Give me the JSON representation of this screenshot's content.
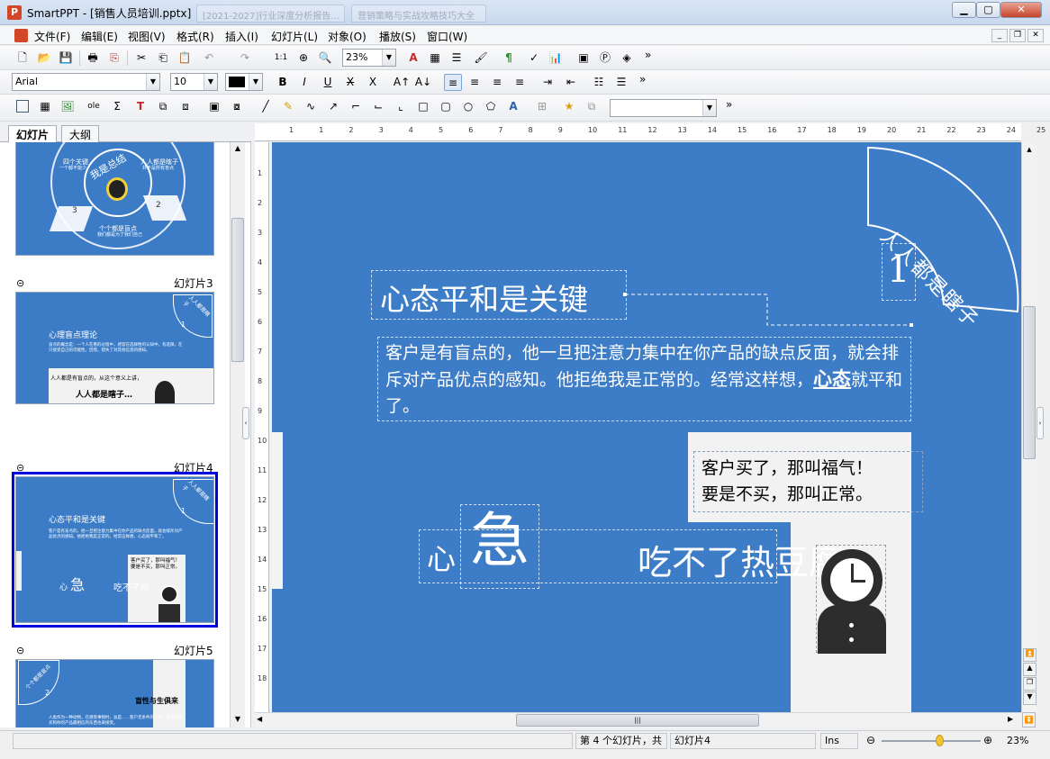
{
  "window": {
    "app_name": "SmartPPT",
    "title": "SmartPPT - [销售人员培训.pptx]",
    "ghost_tab1": "[2021-2027]行业深度分析报告...",
    "ghost_tab2": "营销策略与实战攻略技巧大全"
  },
  "menu": [
    "文件(F)",
    "编辑(E)",
    "视图(V)",
    "格式(R)",
    "插入(I)",
    "幻灯片(L)",
    "对象(O)",
    "播放(S)",
    "窗口(W)"
  ],
  "toolbar": {
    "zoom_value": "23%",
    "font_name": "Arial",
    "font_size": "10",
    "shape_combo": "",
    "more": "»"
  },
  "panel": {
    "tab_slides": "幻灯片",
    "tab_outline": "大纲"
  },
  "thumbnails": {
    "slide2": {
      "left_heading": "四个关键",
      "left_sub": "一个都不能少",
      "right_heading": "人人都是瞎子",
      "right_sub": "并不是所有盲点",
      "center": "我是总结",
      "num3": "3",
      "num2": "2",
      "bottom_heading": "个个都是盲点",
      "bottom_sub": "我们都是为了我们自己"
    },
    "slide3": {
      "label": "幻灯片3",
      "title": "心理盲点理论",
      "tag": "人人都是瞎子",
      "num": "1",
      "body": "盲点的概念是：一个人在看的过程中，感官在选择性的认知中，有选择，在只接受自己的可能性，因而，错失了对其他信息的感知。",
      "box_line": "人人都是有盲点的，从这个意义上讲，",
      "box_big": "人人都是瞎子…"
    },
    "slide4": {
      "label": "幻灯片4",
      "title": "心态平和是关键",
      "tag": "人人都是瞎子",
      "num": "1",
      "body": "客户是有盲点的，他一旦把注意力集中在你产品的缺点反面，就会排斥对产品优点的感知。他拒绝我是正常的。经常这样想，心态就平和了。",
      "box": "客户买了，那叫福气！要是不买，那叫正常。",
      "xin": "心",
      "ji": "急",
      "rest": "吃不了热"
    },
    "slide5": {
      "label": "幻灯片5",
      "tag": "个个都是盲点",
      "num": "2",
      "heading": "盲性与生俱来",
      "body": "人类作为一种动物，在感受事物时，总是……客户无条件的产品，总是对购买和你的产品最相信的东西也来接受。"
    }
  },
  "slide": {
    "arc_text": "人人都是瞎子",
    "arc_num": "1",
    "title": "心态平和是关键",
    "body_part1": "客户是有盲点的，他一旦把注意力集中在你产品的缺点反面，就会排斥对产品优点的感知。他拒绝我是正常的。经常这样想，",
    "body_bold": "心态",
    "body_part2": "就平和了。",
    "box_line1": "客户买了，那叫福气！",
    "box_line2": "要是不买，那叫正常。",
    "xin": "心",
    "ji": "急",
    "rest": "吃不了热豆腐"
  },
  "ruler": {
    "h": [
      "1",
      "1",
      "2",
      "3",
      "4",
      "5",
      "6",
      "7",
      "8",
      "9",
      "10",
      "11",
      "12",
      "13",
      "14",
      "15",
      "16",
      "17",
      "18",
      "19",
      "20",
      "21",
      "22",
      "23",
      "24",
      "25"
    ],
    "v": [
      "1",
      "2",
      "3",
      "4",
      "5",
      "6",
      "7",
      "8",
      "9",
      "10",
      "11",
      "12",
      "13",
      "14",
      "15",
      "16",
      "17",
      "18"
    ]
  },
  "status": {
    "slide_info": "第 4 个幻灯片，共",
    "slide_name": "幻灯片4",
    "ins": "Ins",
    "zoom": "23%",
    "zoom_fraction": 0.58
  },
  "colors": {
    "slide_bg": "#3d7cc6",
    "selection": "#0000e0"
  }
}
